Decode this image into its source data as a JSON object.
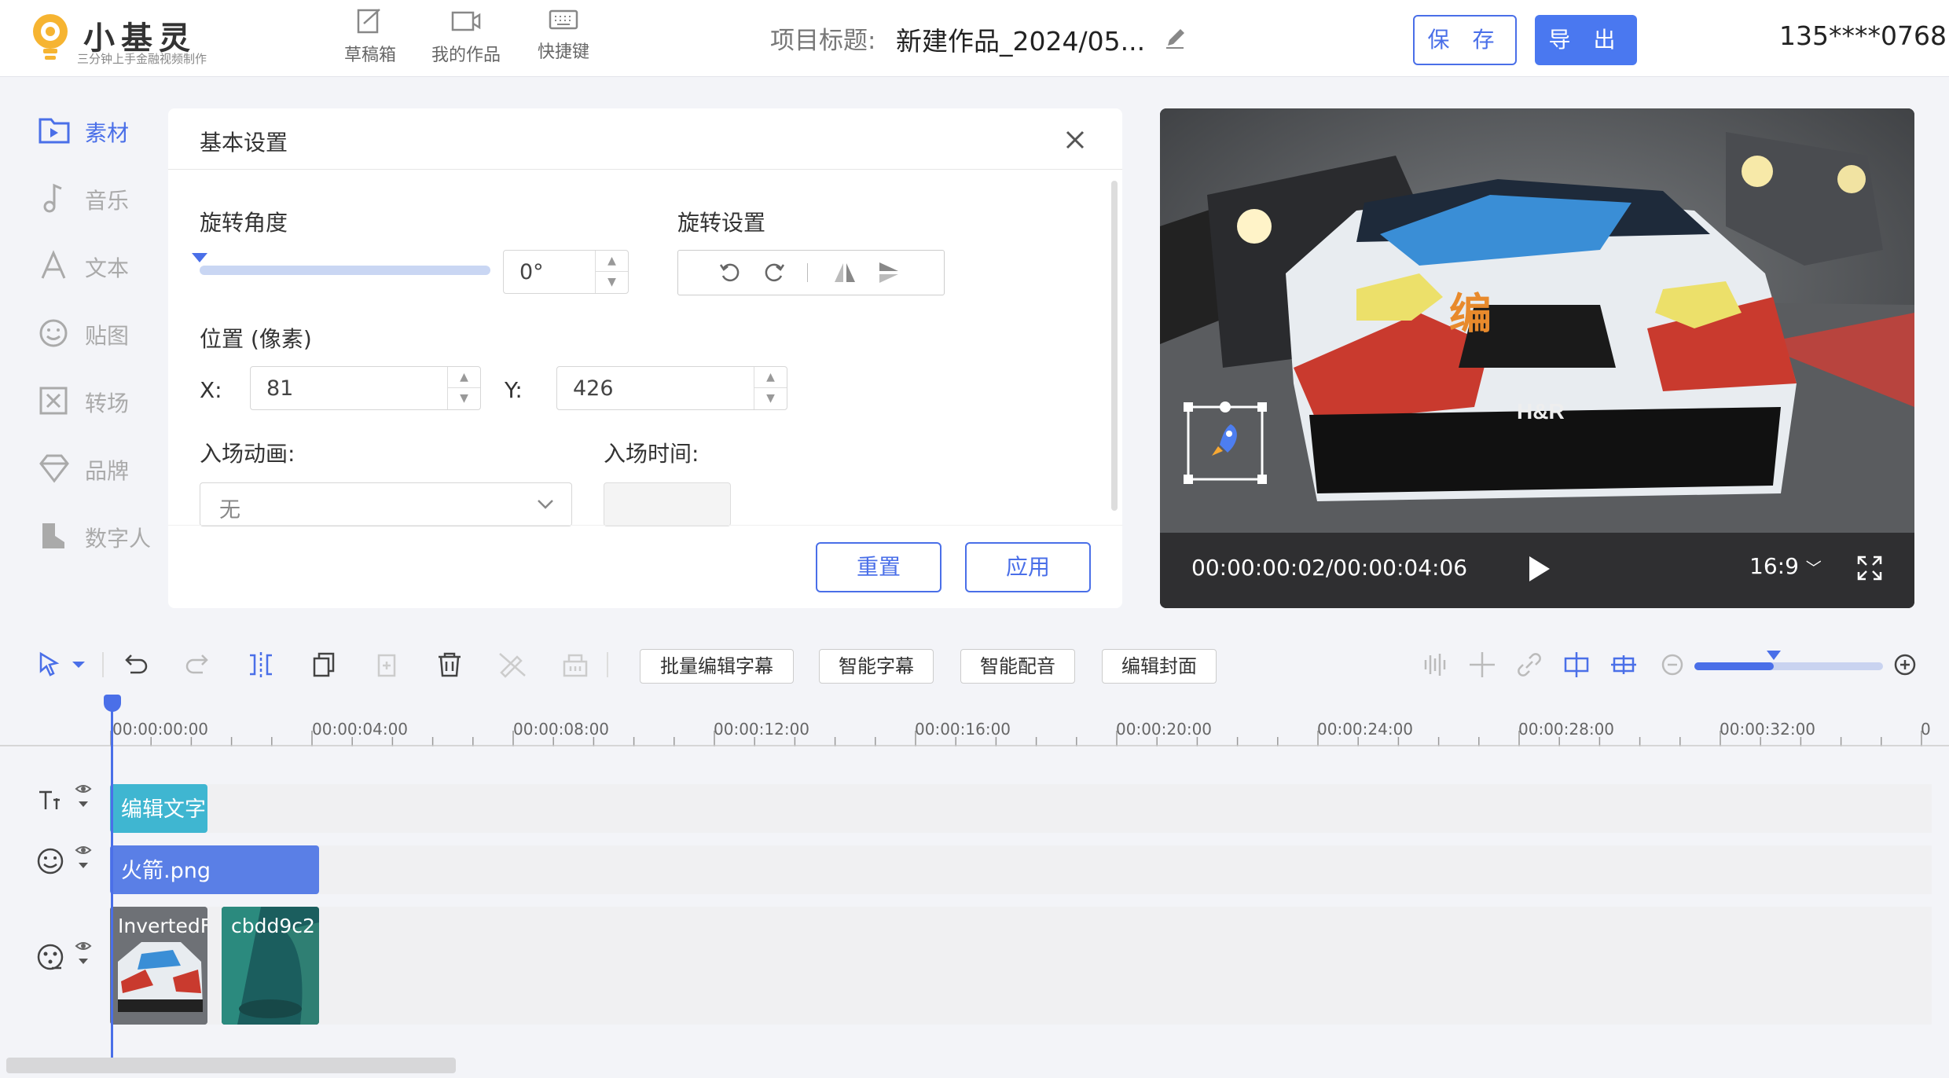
{
  "header": {
    "logo_title": "小基灵",
    "logo_subtitle": "三分钟上手金融视频制作",
    "nav": [
      {
        "label": "草稿箱",
        "icon": "drafts-icon"
      },
      {
        "label": "我的作品",
        "icon": "video-icon"
      },
      {
        "label": "快捷键",
        "icon": "keyboard-icon"
      }
    ],
    "project_label": "项目标题:",
    "project_title": "新建作品_2024/05...",
    "save_label": "保 存",
    "export_label": "导 出",
    "user": "135****0768"
  },
  "sidebar": {
    "items": [
      {
        "label": "素材",
        "icon": "material-icon",
        "active": true
      },
      {
        "label": "音乐",
        "icon": "music-icon"
      },
      {
        "label": "文本",
        "icon": "text-icon"
      },
      {
        "label": "贴图",
        "icon": "sticker-icon"
      },
      {
        "label": "转场",
        "icon": "transition-icon"
      },
      {
        "label": "品牌",
        "icon": "brand-icon"
      },
      {
        "label": "数字人",
        "icon": "digital-human-icon"
      }
    ]
  },
  "settings": {
    "title": "基本设置",
    "rotation_label": "旋转角度",
    "rotation_value": "0°",
    "rotation_level": 0,
    "rotation_settings_label": "旋转设置",
    "position_label": "位置 (像素)",
    "x_label": "X:",
    "x_value": "81",
    "y_label": "Y:",
    "y_value": "426",
    "enter_anim_label": "入场动画:",
    "enter_anim_value": "无",
    "enter_time_label": "入场时间:",
    "enter_time_value": "",
    "reset_label": "重置",
    "apply_label": "应用"
  },
  "preview": {
    "timecode": "00:00:00:02/00:00:04:06",
    "ratio": "16:9"
  },
  "toolbar": {
    "batch_subtitle": "批量编辑字幕",
    "smart_subtitle": "智能字幕",
    "smart_dub": "智能配音",
    "edit_cover": "编辑封面",
    "zoom_level": 0.42
  },
  "timeline": {
    "ticks": [
      "00:00:00:00",
      "00:00:04:00",
      "00:00:08:00",
      "00:00:12:00",
      "00:00:16:00",
      "00:00:20:00",
      "00:00:24:00",
      "00:00:28:00",
      "00:00:32:00",
      "0"
    ],
    "text_clip": "编辑文字",
    "sticker_clip": "火箭.png",
    "video_clips": [
      "InvertedF",
      "cbdd9c2"
    ]
  },
  "colors": {
    "accent": "#4a6fe8",
    "text_clip": "#3fb6d1",
    "sticker_clip": "#5a7fe6"
  }
}
